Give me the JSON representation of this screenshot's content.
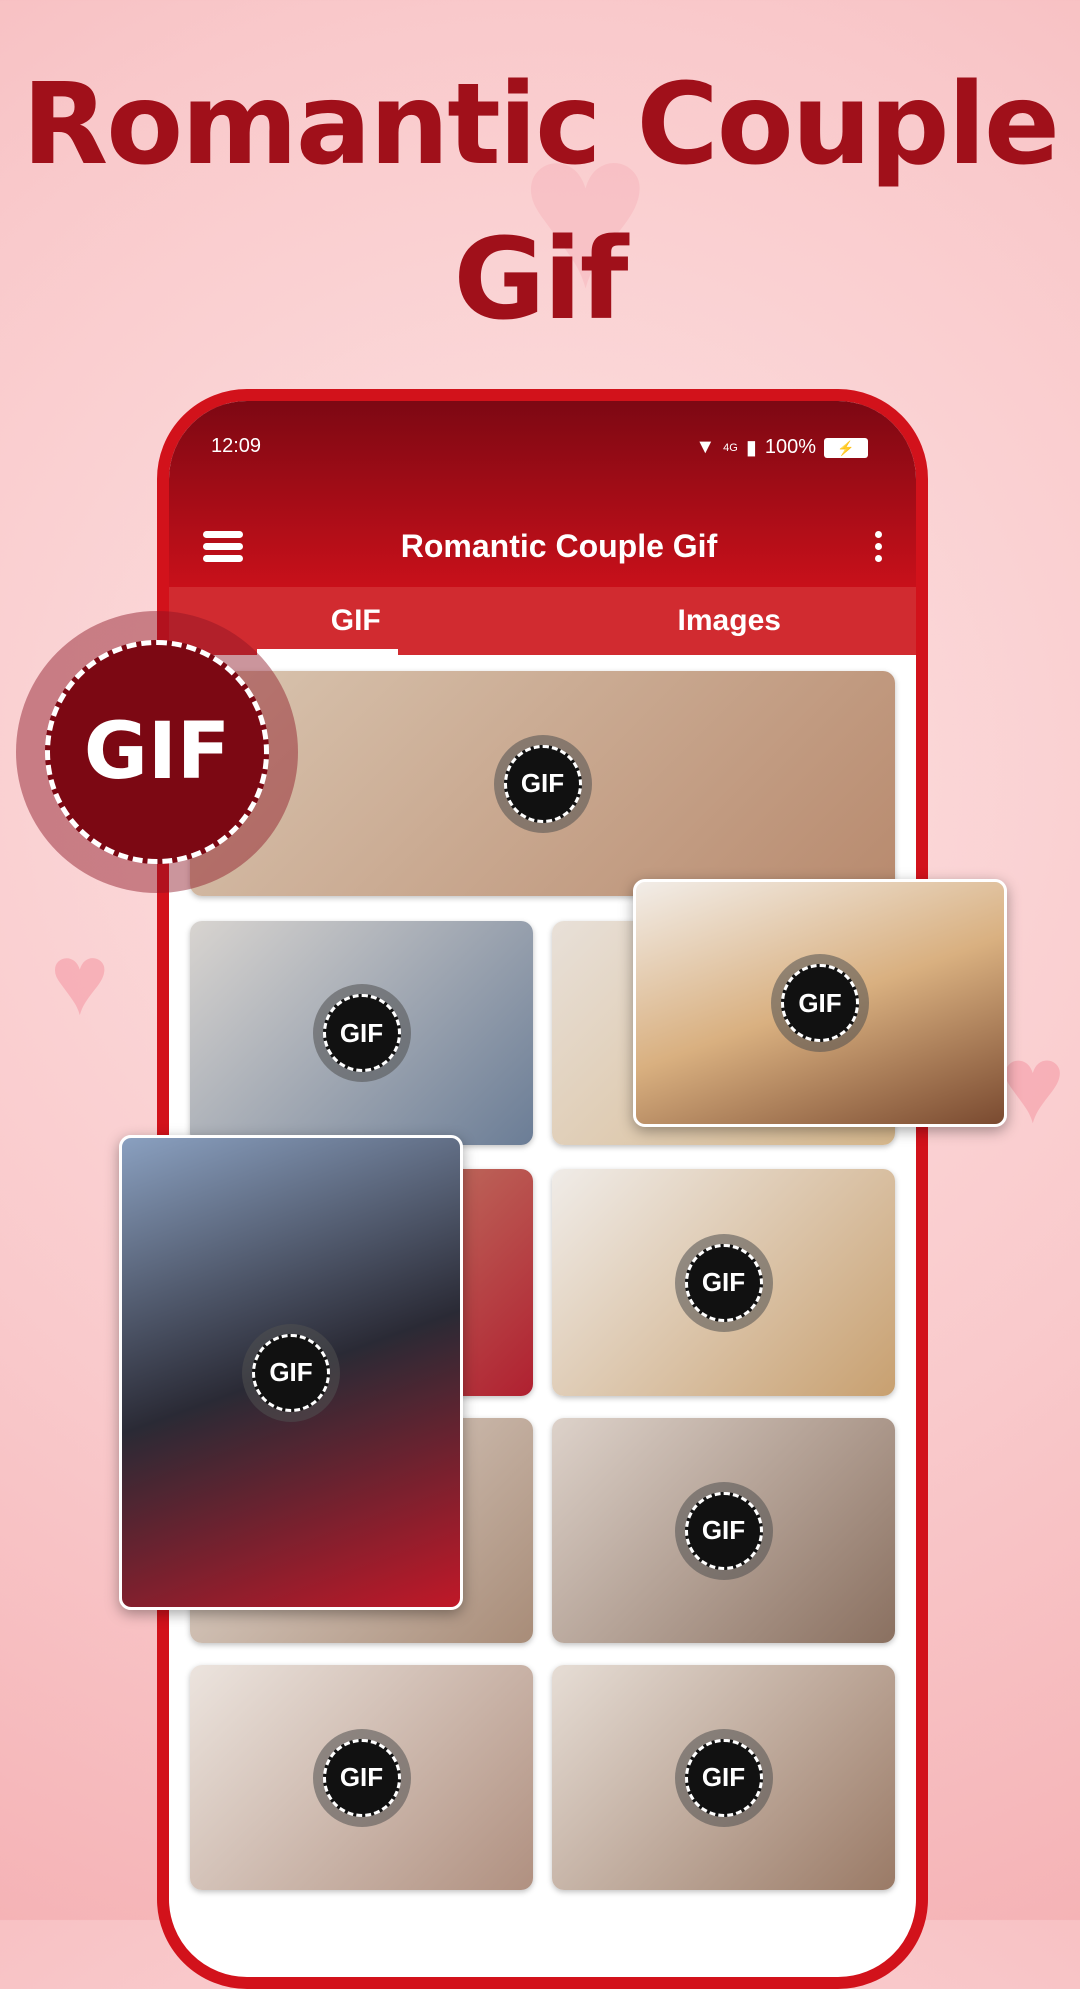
{
  "promo": {
    "line1": "Romantic Couple",
    "line2": "Gif"
  },
  "status": {
    "time": "12:09",
    "network": "4G",
    "battery": "100%"
  },
  "appbar": {
    "title": "Romantic Couple Gif"
  },
  "tabs": [
    {
      "label": "GIF",
      "active": true
    },
    {
      "label": "Images",
      "active": false
    }
  ],
  "badge_label": "GIF",
  "colors": {
    "primary": "#c8101a",
    "dark": "#7c0813",
    "tabbar": "#d12b30"
  },
  "icons": [
    "wifi-icon",
    "signal-icon",
    "battery-charging-icon",
    "menu-icon",
    "more-vertical-icon"
  ]
}
